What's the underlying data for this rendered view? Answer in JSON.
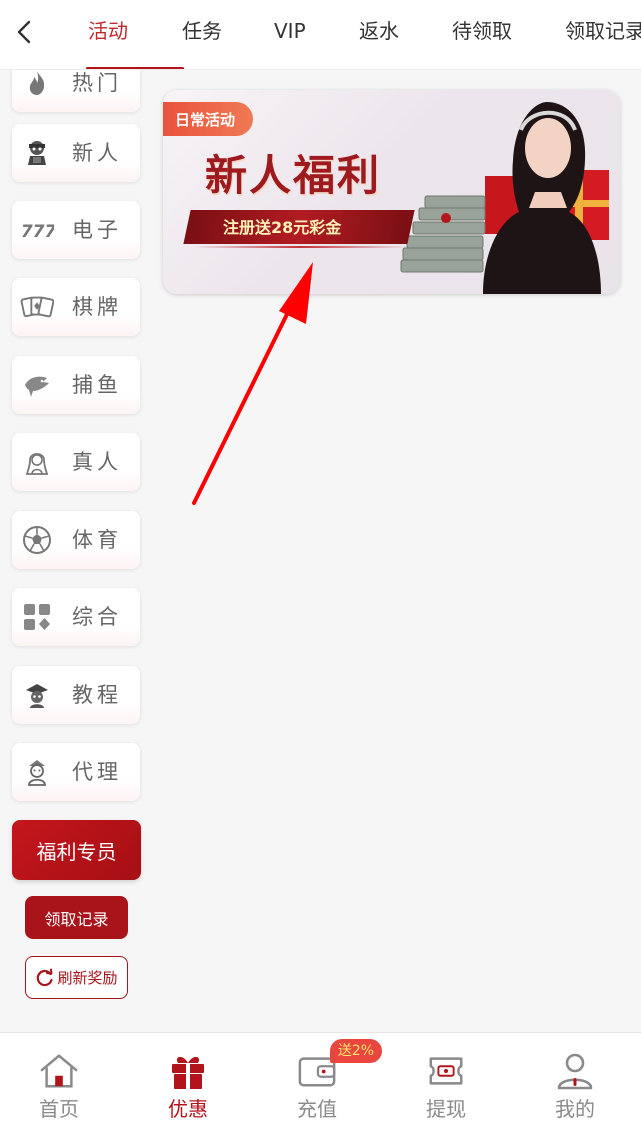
{
  "topnav": {
    "tabs": [
      {
        "label": "活动",
        "active": true
      },
      {
        "label": "任务"
      },
      {
        "label": "VIP"
      },
      {
        "label": "返水"
      },
      {
        "label": "待领取"
      },
      {
        "label": "领取记录"
      }
    ]
  },
  "sidebar": {
    "categories": [
      {
        "label": "热门",
        "icon": "fire-icon"
      },
      {
        "label": "新人",
        "icon": "newbie-icon"
      },
      {
        "label": "电子",
        "icon": "slot-777-icon"
      },
      {
        "label": "棋牌",
        "icon": "cards-icon"
      },
      {
        "label": "捕鱼",
        "icon": "fish-icon"
      },
      {
        "label": "真人",
        "icon": "dealer-icon"
      },
      {
        "label": "体育",
        "icon": "football-icon"
      },
      {
        "label": "综合",
        "icon": "grid-icon"
      },
      {
        "label": "教程",
        "icon": "tutorial-icon"
      },
      {
        "label": "代理",
        "icon": "agent-icon"
      }
    ],
    "welfare_label": "福利专员",
    "records_label": "领取记录",
    "refresh_label": "刷新奖励"
  },
  "banner": {
    "tag": "日常活动",
    "title": "新人福利",
    "subtitle": "注册送28元彩金"
  },
  "bottomnav": {
    "items": [
      {
        "label": "首页",
        "icon": "home-icon"
      },
      {
        "label": "优惠",
        "icon": "gift-icon",
        "active": true
      },
      {
        "label": "充值",
        "icon": "wallet-icon"
      },
      {
        "label": "提现",
        "icon": "withdraw-icon"
      },
      {
        "label": "我的",
        "icon": "user-icon"
      }
    ],
    "recharge_badge": "送2%"
  },
  "colors": {
    "accent": "#b3141c",
    "annotation": "#ff0000"
  }
}
